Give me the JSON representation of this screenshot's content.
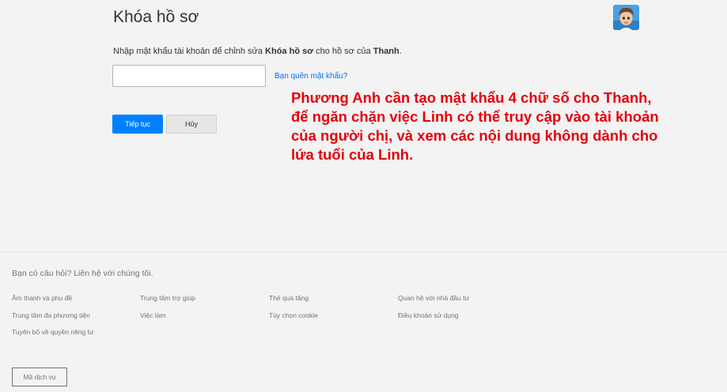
{
  "page": {
    "title": "Khóa hồ sơ"
  },
  "instructions": {
    "prefix": "Nhập mật khẩu tài khoản để chỉnh sửa ",
    "setting": "Khóa hồ sơ",
    "middle": " cho hồ sơ của ",
    "profile_name": "Thanh",
    "suffix": "."
  },
  "password": {
    "value": "",
    "placeholder": ""
  },
  "forgot_password_link": "Bạn quên mật khẩu?",
  "buttons": {
    "continue": "Tiếp tục",
    "cancel": "Hủy"
  },
  "annotation": {
    "lines": [
      "Phương Anh cần tạo mật khẩu 4 chữ số cho Thanh,",
      "để ngăn chặn việc Linh có thể truy cập vào tài khoản",
      "của người chị, và xem các nội dung không dành cho",
      "lứa tuổi của Linh."
    ],
    "color": "#e5000b"
  },
  "footer": {
    "question": "Bạn có câu hỏi? Liên hệ với chúng tôi.",
    "links": [
      "Âm thanh và phụ đề",
      "Trung tâm trợ giúp",
      "Thẻ quà tặng",
      "Quan hệ với nhà đầu tư",
      "Trung tâm đa phương tiện",
      "Việc làm",
      "Tùy chọn cookie",
      "Điều khoản sử dụng",
      "Tuyên bố về quyền riêng tư"
    ],
    "service_code": "Mã dịch vụ"
  },
  "colors": {
    "accent": "#0080ff",
    "link": "#0071eb",
    "background": "#f3f3f3"
  }
}
